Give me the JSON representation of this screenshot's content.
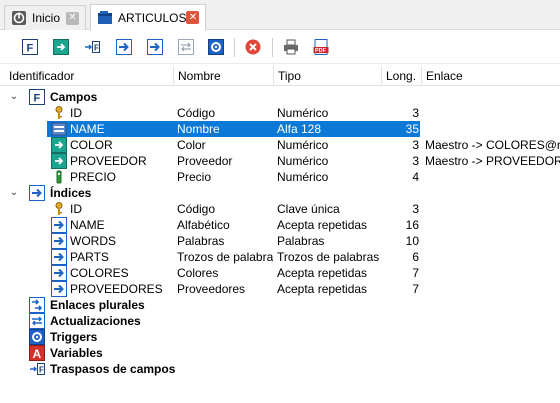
{
  "tabs": [
    {
      "label": "Inicio",
      "icon": "home-icon",
      "active": false
    },
    {
      "label": "ARTICULOS",
      "icon": "table-file-icon",
      "active": true
    }
  ],
  "toolbar": {
    "buttons": [
      "fields-icon",
      "arrow-right-icon",
      "import-arrow-icon",
      "arrow-right-icon",
      "arrow-right-icon",
      "update-arrows-icon",
      "gear-icon",
      "delete-icon",
      "print-icon",
      "pdf-icon"
    ]
  },
  "header": {
    "identificador": "Identificador",
    "nombre": "Nombre",
    "tipo": "Tipo",
    "long": "Long.",
    "enlace": "Enlace"
  },
  "campos": {
    "label": "Campos",
    "icon": "fields-icon",
    "rows": [
      {
        "id": "ID",
        "nombre": "Código",
        "tipo": "Numérico",
        "long": "3",
        "enlace": "",
        "icon": "key-icon"
      },
      {
        "id": "NAME",
        "nombre": "Nombre",
        "tipo": "Alfa 128",
        "long": "35",
        "enlace": "",
        "icon": "field-icon"
      },
      {
        "id": "COLOR",
        "nombre": "Color",
        "tipo": "Numérico",
        "long": "3",
        "enlace": "Maestro -> COLORES@rsi",
        "icon": "link-field-icon"
      },
      {
        "id": "PROVEEDOR",
        "nombre": "Proveedor",
        "tipo": "Numérico",
        "long": "3",
        "enlace": "Maestro -> PROVEEDORES",
        "icon": "link-field-icon"
      },
      {
        "id": "PRECIO",
        "nombre": "Precio",
        "tipo": "Numérico",
        "long": "4",
        "enlace": "",
        "icon": "numeric-field-icon"
      }
    ]
  },
  "indices": {
    "label": "Índices",
    "icon": "index-icon",
    "rows": [
      {
        "id": "ID",
        "nombre": "Código",
        "tipo": "Clave única",
        "long": "3",
        "icon": "key-icon"
      },
      {
        "id": "NAME",
        "nombre": "Alfabético",
        "tipo": "Acepta repetidas",
        "long": "16",
        "icon": "index-icon"
      },
      {
        "id": "WORDS",
        "nombre": "Palabras",
        "tipo": "Palabras",
        "long": "10",
        "icon": "index-icon"
      },
      {
        "id": "PARTS",
        "nombre": "Trozos de palabras",
        "tipo": "Trozos de palabras",
        "long": "6",
        "icon": "index-icon"
      },
      {
        "id": "COLORES",
        "nombre": "Colores",
        "tipo": "Acepta repetidas",
        "long": "7",
        "icon": "index-icon"
      },
      {
        "id": "PROVEEDORES",
        "nombre": "Proveedores",
        "tipo": "Acepta repetidas",
        "long": "7",
        "icon": "index-icon"
      }
    ]
  },
  "sections": [
    {
      "label": "Enlaces plurales",
      "icon": "plural-links-icon"
    },
    {
      "label": "Actualizaciones",
      "icon": "updates-icon"
    },
    {
      "label": "Triggers",
      "icon": "gear-icon"
    },
    {
      "label": "Variables",
      "icon": "variables-icon"
    },
    {
      "label": "Traspasos de campos",
      "icon": "field-transfer-icon"
    }
  ],
  "selected_row": "NAME",
  "colors": {
    "selection": "#0c79d6",
    "accent_blue": "#1e62c8",
    "teal": "#1aa58f",
    "close_red": "#e0543b"
  }
}
